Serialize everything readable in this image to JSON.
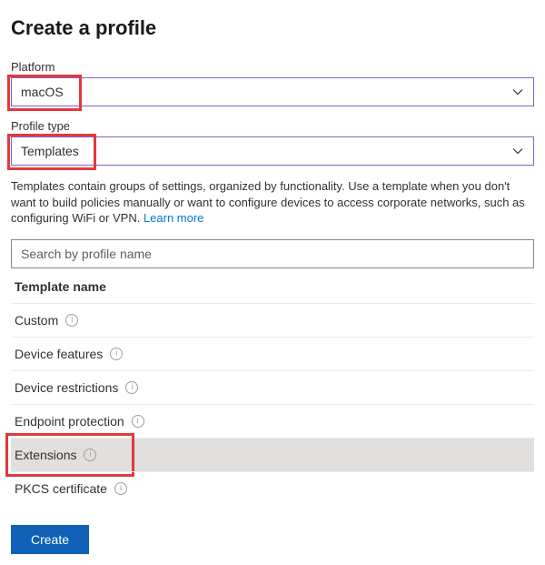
{
  "title": "Create a profile",
  "platform": {
    "label": "Platform",
    "value": "macOS"
  },
  "profile_type": {
    "label": "Profile type",
    "value": "Templates"
  },
  "description": "Templates contain groups of settings, organized by functionality. Use a template when you don't want to build policies manually or want to configure devices to access corporate networks, such as configuring WiFi or VPN. ",
  "learn_more": "Learn more",
  "search_placeholder": "Search by profile name",
  "column_header": "Template name",
  "templates": [
    {
      "name": "Custom"
    },
    {
      "name": "Device features"
    },
    {
      "name": "Device restrictions"
    },
    {
      "name": "Endpoint protection"
    },
    {
      "name": "Extensions"
    },
    {
      "name": "PKCS certificate"
    }
  ],
  "create_label": "Create",
  "colors": {
    "accent": "#0f60b6",
    "select_border": "#8661c5",
    "highlight_red": "#e1393c"
  }
}
